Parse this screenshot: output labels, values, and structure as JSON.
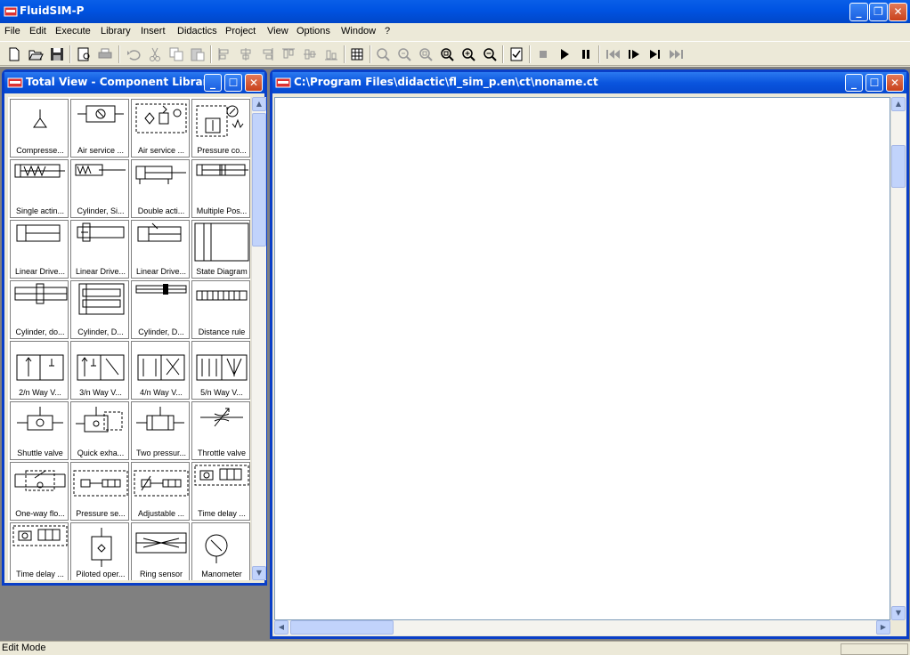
{
  "app": {
    "title": "FluidSIM-P"
  },
  "menu": [
    "File",
    "Edit",
    "Execute",
    "Library",
    "Insert",
    "Didactics",
    "Project",
    "View",
    "Options",
    "Window",
    "?"
  ],
  "library_window": {
    "title": "Total View - Component Library",
    "items": [
      "Compresse...",
      "Air service ...",
      "Air service ...",
      "Pressure co...",
      "Single actin...",
      "Cylinder, Si...",
      "Double acti...",
      "Multiple Pos...",
      "Linear Drive...",
      "Linear Drive...",
      "Linear Drive...",
      "State Diagram",
      "Cylinder, do...",
      "Cylinder, D...",
      "Cylinder, D...",
      "Distance rule",
      "2/n Way V...",
      "3/n Way V...",
      "4/n Way V...",
      "5/n Way V...",
      "Shuttle valve",
      "Quick exha...",
      "Two pressur...",
      "Throttle valve",
      "One-way flo...",
      "Pressure se...",
      "Adjustable ...",
      "Time delay ...",
      "Time delay ...",
      "Piloted oper...",
      "Ring sensor",
      "Manometer"
    ]
  },
  "circuit_window": {
    "title": "C:\\Program Files\\didactic\\fl_sim_p.en\\ct\\noname.ct"
  },
  "status": {
    "mode": "Edit Mode"
  }
}
